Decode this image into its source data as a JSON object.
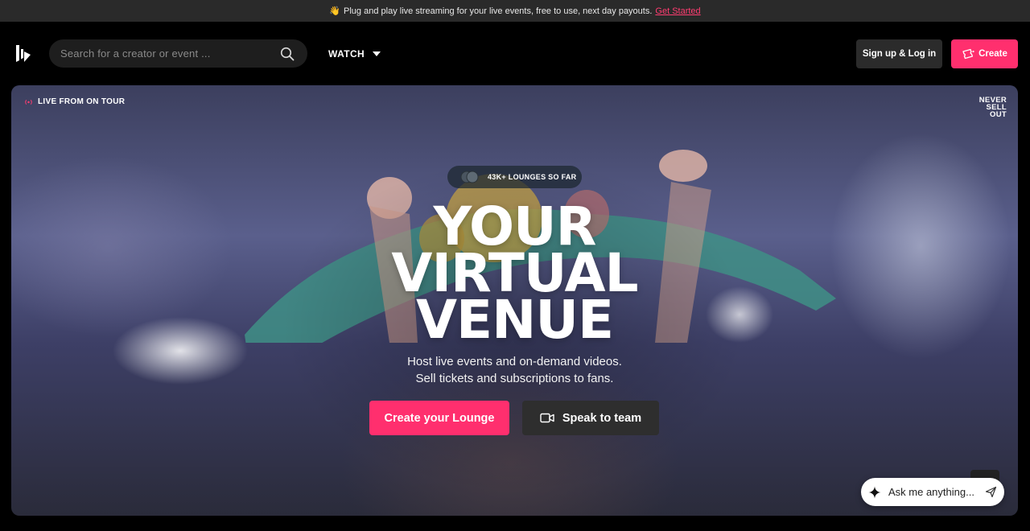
{
  "announcement": {
    "emoji": "👋",
    "text": "Plug and play live streaming for your live events, free to use, next day payouts.",
    "link": "Get Started"
  },
  "header": {
    "search_placeholder": "Search for a creator or event ...",
    "watch_label": "WATCH",
    "signin_label": "Sign up & Log in",
    "create_label": "Create"
  },
  "hero": {
    "live_tag": "LIVE FROM ON TOUR",
    "corner_lines": [
      "NEVER",
      "SELL",
      "OUT"
    ],
    "pill_label": "43K+ LOUNGES SO FAR",
    "headline": [
      "YOUR",
      "VIRTUAL",
      "VENUE"
    ],
    "subtitle": [
      "Host live events and on-demand videos.",
      "Sell tickets and subscriptions to fans."
    ],
    "cta_primary": "Create your Lounge",
    "cta_secondary": "Speak to team"
  },
  "assistant": {
    "placeholder": "Ask me anything..."
  },
  "colors": {
    "accent": "#ff2f6e",
    "announce_bg": "#2a2a2a",
    "button_dark": "#2b2b2b"
  }
}
